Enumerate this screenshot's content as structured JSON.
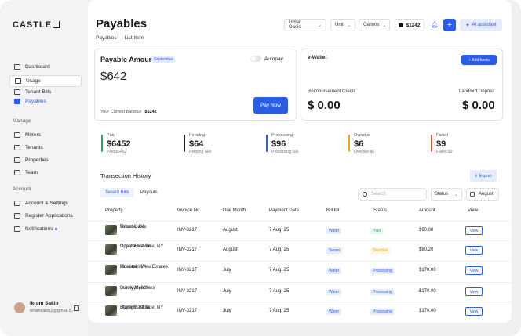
{
  "brand": {
    "logo": "CASTLE"
  },
  "sidebar": {
    "items": [
      {
        "label": "Dashboard"
      },
      {
        "label": "Usage"
      },
      {
        "label": "Tenant Bills"
      },
      {
        "label": "Payables"
      }
    ],
    "manage_header": "Manage",
    "manage_items": [
      {
        "label": "Meters"
      },
      {
        "label": "Tenants"
      },
      {
        "label": "Properties"
      },
      {
        "label": "Team"
      }
    ],
    "account_header": "Account",
    "account_items": [
      {
        "label": "Account & Settings"
      },
      {
        "label": "Register Applications"
      },
      {
        "label": "Notifications"
      }
    ],
    "user": {
      "name": "Ikram Sakib",
      "email": "ikramsakib2@gmail.c..."
    }
  },
  "header": {
    "title": "Payables",
    "breadcrumbs": [
      "Payables",
      "List Item"
    ],
    "filters": [
      "Urban Oasis",
      "Unit",
      "Gallons"
    ],
    "wallet_amount": "$1242",
    "ai_label": "AI assistant"
  },
  "payable": {
    "title": "Payable Amount",
    "month": "September",
    "autopay_label": "Autopay",
    "amount": "$642",
    "balance_label": "Your Current Balance",
    "balance_value": "$1242",
    "pay_label": "Pay Now"
  },
  "ewallet": {
    "title": "e-Wallet",
    "add_label": "+ Add funds",
    "reimbursement_label": "Reimbursement Credit",
    "reimbursement_value": "$ 0.00",
    "deposit_label": "Landlord Deposit",
    "deposit_value": "$ 0.00"
  },
  "stats": [
    {
      "label": "Paid",
      "value": "$6452",
      "sub": "Paid $6452",
      "color": "#2eaa5b"
    },
    {
      "label": "Pending",
      "value": "$64",
      "sub": "Pending $64",
      "color": "#222222"
    },
    {
      "label": "Processing",
      "value": "$96",
      "sub": "Processing $96",
      "color": "#2b5ce6"
    },
    {
      "label": "Overdue",
      "value": "$6",
      "sub": "Overdue   $6",
      "color": "#e6a817"
    },
    {
      "label": "Failed",
      "value": "$9",
      "sub": "Failed $9",
      "color": "#e0533d"
    }
  ],
  "history": {
    "title": "Transection History",
    "export_label": "Export",
    "tabs": [
      "Tenant Bills",
      "Payouts"
    ],
    "search_placeholder": "Search",
    "status_filter": "Status",
    "month_filter": "August",
    "columns": [
      "Property",
      "Invoice No.",
      "Due Month",
      "Payment Date",
      "Bill for",
      "Status",
      "Amount",
      "View"
    ],
    "rows": [
      {
        "name": "Urban Oasis",
        "location": "Toronto, CA",
        "invoice": "INV-3217",
        "due": "August",
        "date": "7 Aug, 25",
        "bill": "Water",
        "status": "Paid",
        "amount": "$90.00",
        "view": "View"
      },
      {
        "name": "Coastal Haven",
        "location": "Upper East Side, NY",
        "invoice": "INV-3217",
        "due": "August",
        "date": "7 Aug, 25",
        "bill": "Sewer",
        "status": "Overdue",
        "amount": "$80.20",
        "view": "View"
      },
      {
        "name": "Mountain View Estates",
        "location": "Queens, NY",
        "invoice": "INV-3217",
        "due": "July",
        "date": "7 Aug, 25",
        "bill": "Water",
        "status": "Processing",
        "amount": "$170.00",
        "view": "View"
      },
      {
        "name": "Sunny Meadows",
        "location": "Brooklyn, NY",
        "invoice": "INV-3217",
        "due": "July",
        "date": "7 Aug, 25",
        "bill": "Water",
        "status": "Processing",
        "amount": "$170.00",
        "view": "View"
      },
      {
        "name": "Starlight Villas",
        "location": "Upper East Side, NY",
        "invoice": "INV-3217",
        "due": "July",
        "date": "7 Aug, 25",
        "bill": "Water",
        "status": "Processing",
        "amount": "$170.00",
        "view": "View"
      }
    ]
  },
  "colors": {
    "accent": "#2b5ce6",
    "paid": "#2eaa5b",
    "overdue": "#e6a817"
  }
}
